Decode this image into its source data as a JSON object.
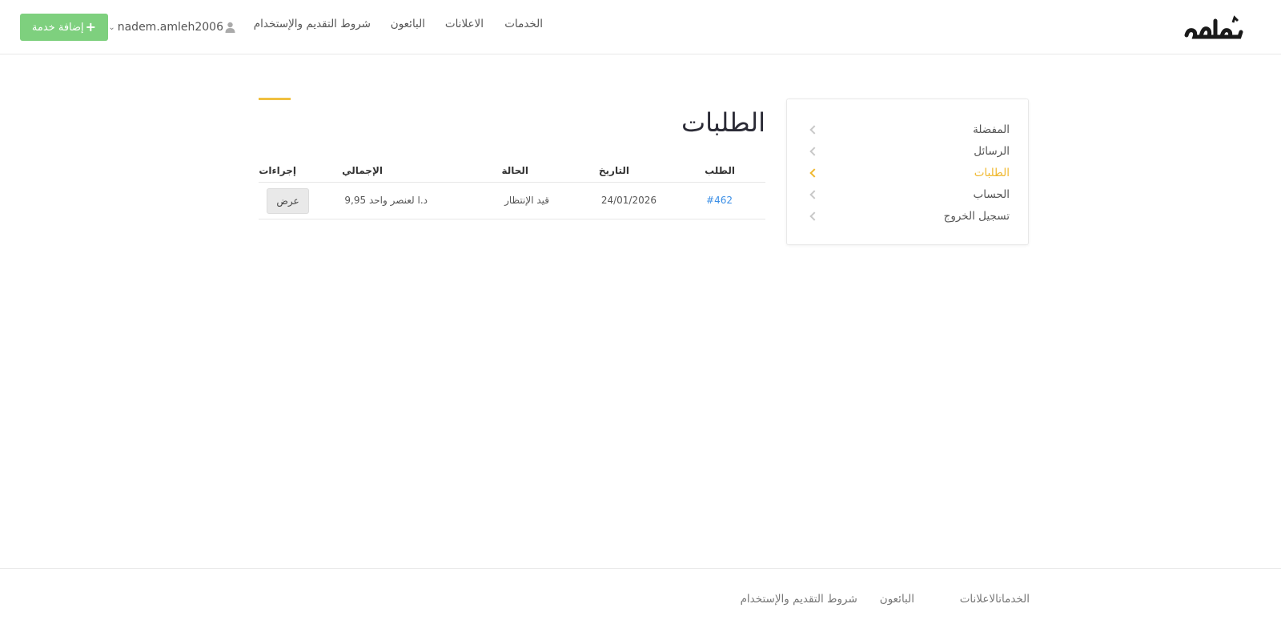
{
  "header": {
    "logo_text": "خدوم",
    "nav": {
      "services": "الخدمات",
      "ads": "الاعلانات",
      "sellers": "البائعون",
      "terms": "شروط التقديم والإستخدام"
    },
    "username": "nadem.amleh2006",
    "add_service_label": "إضافة خدمة"
  },
  "sidebar": {
    "items": [
      {
        "label": "المفضلة",
        "active": false
      },
      {
        "label": "الرسائل",
        "active": false
      },
      {
        "label": "الطلبات",
        "active": true
      },
      {
        "label": "الحساب",
        "active": false
      },
      {
        "label": "تسجيل الخروج",
        "active": false
      }
    ]
  },
  "main": {
    "title": "الطلبات",
    "table": {
      "headers": {
        "order": "الطلب",
        "date": "التاريخ",
        "status": "الحالة",
        "total": "الإجمالي",
        "actions": "إجراءات"
      },
      "rows": [
        {
          "order": "#462",
          "date": "24/01/2026",
          "status": "قيد الإنتظار",
          "total": "9,95 د.ا لعنصر واحد",
          "action": "عرض"
        }
      ]
    }
  },
  "footer": {
    "links": {
      "services_ads": "الخدماتالاعلانات",
      "sellers": "البائعون",
      "terms": "شروط التقديم والإستخدام"
    }
  },
  "colors": {
    "accent": "#f0b82e",
    "add_button": "#7ed07e",
    "link": "#3a8ee6"
  }
}
